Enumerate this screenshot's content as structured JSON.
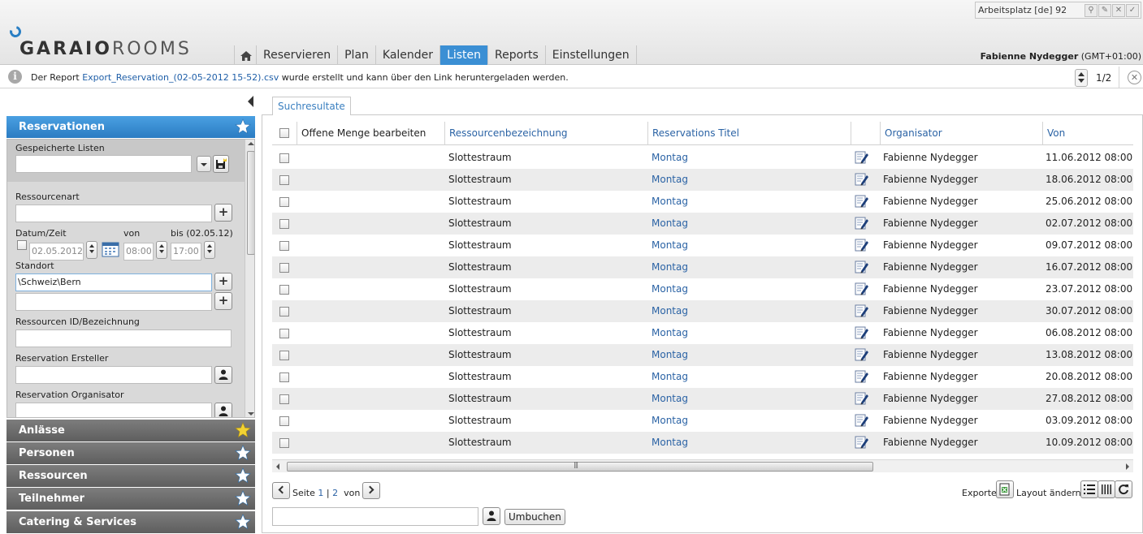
{
  "header": {
    "logo": {
      "bold": "GARAIO",
      "light": "ROOMS"
    },
    "workspace": "Arbeitsplatz [de] 92",
    "nav": [
      "Reservieren",
      "Plan",
      "Kalender",
      "Listen",
      "Reports",
      "Einstellungen"
    ],
    "nav_active": "Listen",
    "user": {
      "name": "Fabienne Nydegger",
      "tz": " (GMT+01:00)"
    }
  },
  "notification": {
    "prefix": "Der Report ",
    "link": "Export_Reservation_(02-05-2012 15-52).csv",
    "suffix": " wurde erstellt und kann über den Link heruntergeladen werden.",
    "page": "1/2"
  },
  "left_panel": {
    "sections": [
      {
        "label": "Reservationen",
        "active": true,
        "star": "white-star-icon"
      },
      {
        "label": "Anlässe",
        "active": false,
        "star": "yellow-star-icon"
      },
      {
        "label": "Personen",
        "active": false,
        "star": "white-star-icon"
      },
      {
        "label": "Ressourcen",
        "active": false,
        "star": "white-star-icon"
      },
      {
        "label": "Teilnehmer",
        "active": false,
        "star": "white-star-icon"
      },
      {
        "label": "Catering & Services",
        "active": false,
        "star": "white-star-icon"
      }
    ],
    "filters": {
      "saved_lists_label": "Gespeicherte Listen",
      "saved_lists_value": "",
      "resource_type_label": "Ressourcenart",
      "resource_type_value": "",
      "datetime_label": "Datum/Zeit",
      "von_label": "von",
      "bis_label": "bis (02.05.12)",
      "date_value": "02.05.2012",
      "from_time": "08:00",
      "to_time": "17:00",
      "location_label": "Standort",
      "location_value": "\\Schweiz\\Bern",
      "location_value2": "",
      "resource_id_label": "Ressourcen ID/Bezeichnung",
      "resource_id_value": "",
      "creator_label": "Reservation Ersteller",
      "creator_value": "",
      "organizer_label": "Reservation Organisator",
      "organizer_value": ""
    }
  },
  "results": {
    "tab": "Suchresultate",
    "columns": {
      "col1": "Offene Menge bearbeiten",
      "col2": "Ressourcenbezeichnung",
      "col3": "Reservations Titel",
      "col4": "Organisator",
      "col5": "Von"
    },
    "rows": [
      {
        "resource": "Slottestraum",
        "title": "Montag",
        "organizer": "Fabienne Nydegger",
        "from": "11.06.2012 08:00"
      },
      {
        "resource": "Slottestraum",
        "title": "Montag",
        "organizer": "Fabienne Nydegger",
        "from": "18.06.2012 08:00"
      },
      {
        "resource": "Slottestraum",
        "title": "Montag",
        "organizer": "Fabienne Nydegger",
        "from": "25.06.2012 08:00"
      },
      {
        "resource": "Slottestraum",
        "title": "Montag",
        "organizer": "Fabienne Nydegger",
        "from": "02.07.2012 08:00"
      },
      {
        "resource": "Slottestraum",
        "title": "Montag",
        "organizer": "Fabienne Nydegger",
        "from": "09.07.2012 08:00"
      },
      {
        "resource": "Slottestraum",
        "title": "Montag",
        "organizer": "Fabienne Nydegger",
        "from": "16.07.2012 08:00"
      },
      {
        "resource": "Slottestraum",
        "title": "Montag",
        "organizer": "Fabienne Nydegger",
        "from": "23.07.2012 08:00"
      },
      {
        "resource": "Slottestraum",
        "title": "Montag",
        "organizer": "Fabienne Nydegger",
        "from": "30.07.2012 08:00"
      },
      {
        "resource": "Slottestraum",
        "title": "Montag",
        "organizer": "Fabienne Nydegger",
        "from": "06.08.2012 08:00"
      },
      {
        "resource": "Slottestraum",
        "title": "Montag",
        "organizer": "Fabienne Nydegger",
        "from": "13.08.2012 08:00"
      },
      {
        "resource": "Slottestraum",
        "title": "Montag",
        "organizer": "Fabienne Nydegger",
        "from": "20.08.2012 08:00"
      },
      {
        "resource": "Slottestraum",
        "title": "Montag",
        "organizer": "Fabienne Nydegger",
        "from": "27.08.2012 08:00"
      },
      {
        "resource": "Slottestraum",
        "title": "Montag",
        "organizer": "Fabienne Nydegger",
        "from": "03.09.2012 08:00"
      },
      {
        "resource": "Slottestraum",
        "title": "Montag",
        "organizer": "Fabienne Nydegger",
        "from": "10.09.2012 08:00"
      }
    ],
    "pagination": {
      "seite": "Seite",
      "p1": "1",
      "sep": "|",
      "p2": "2",
      "von": "von",
      "total": "2"
    },
    "export_label": "Exporte",
    "layout_label": "Layout ändern",
    "bottom_input": "",
    "umbuchen": "Umbuchen"
  }
}
